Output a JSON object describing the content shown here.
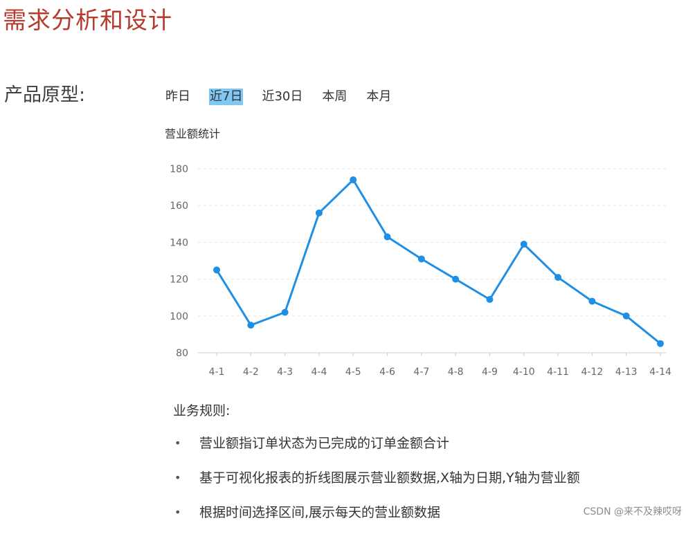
{
  "page": {
    "title": "需求分析和设计",
    "prototype_label": "产品原型:"
  },
  "range_tabs": [
    {
      "label": "昨日",
      "active": false
    },
    {
      "label": "近7日",
      "active": true
    },
    {
      "label": "近30日",
      "active": false
    },
    {
      "label": "本周",
      "active": false
    },
    {
      "label": "本月",
      "active": false
    }
  ],
  "chart_data": {
    "type": "line",
    "title": "营业额统计",
    "x": [
      "4-1",
      "4-2",
      "4-3",
      "4-4",
      "4-5",
      "4-6",
      "4-7",
      "4-8",
      "4-9",
      "4-10",
      "4-11",
      "4-12",
      "4-13",
      "4-14"
    ],
    "series": [
      {
        "values": [
          125,
          95,
          102,
          156,
          174,
          143,
          131,
          120,
          109,
          139,
          121,
          108,
          100,
          85
        ]
      }
    ],
    "ylim": [
      80,
      180
    ],
    "yticks": [
      80,
      100,
      120,
      140,
      160,
      180
    ],
    "grid": true,
    "line_color": "#1f8fe5",
    "grid_color": "#e6e6e6"
  },
  "rules": {
    "title": "业务规则:",
    "items": [
      "营业额指订单状态为已完成的订单金额合计",
      "基于可视化报表的折线图展示营业额数据,X轴为日期,Y轴为营业额",
      "根据时间选择区间,展示每天的营业额数据"
    ],
    "bullet": "•"
  },
  "watermark": "CSDN @来不及辣哎呀"
}
